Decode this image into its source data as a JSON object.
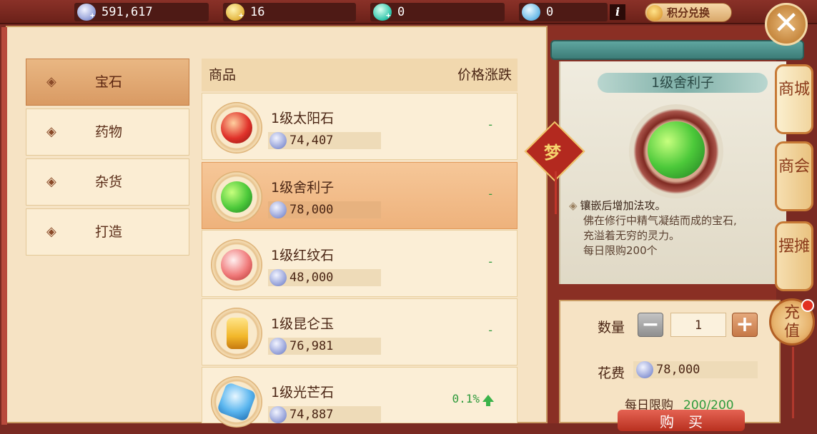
{
  "topbar": {
    "resources": [
      {
        "value": "591,617",
        "icon": "silver-coin-icon"
      },
      {
        "value": "16",
        "icon": "gold-coin-icon"
      },
      {
        "value": "0",
        "icon": "jade-icon"
      },
      {
        "value": "0",
        "icon": "blue-gem-icon"
      }
    ],
    "info_label": "i",
    "exchange_label": "积分兑换",
    "close_label": "✕"
  },
  "categories": [
    {
      "label": "宝石",
      "active": true
    },
    {
      "label": "药物",
      "active": false
    },
    {
      "label": "杂货",
      "active": false
    },
    {
      "label": "打造",
      "active": false
    }
  ],
  "list": {
    "col_item": "商品",
    "col_change": "价格涨跌",
    "items": [
      {
        "name": "1级太阳石",
        "price": "74,407",
        "change": "-",
        "gem_color": "#e0322a"
      },
      {
        "name": "1级舍利子",
        "price": "78,000",
        "change": "-",
        "gem_color": "#4cc93a"
      },
      {
        "name": "1级红纹石",
        "price": "48,000",
        "change": "-",
        "gem_color": "#f07a7a"
      },
      {
        "name": "1级昆仑玉",
        "price": "76,981",
        "change": "-",
        "gem_color": "#f2b72a"
      },
      {
        "name": "1级光芒石",
        "price": "74,887",
        "change": "0.1%",
        "gem_color": "#5bb6ef"
      }
    ]
  },
  "detail": {
    "knot_char": "梦",
    "title": "1级舍利子",
    "lead": "镶嵌后增加法攻。",
    "desc_lines": [
      "佛在修行中精气凝结而成的宝石,",
      "充溢着无穷的灵力。",
      "每日限购200个"
    ]
  },
  "buy": {
    "qty_label": "数量",
    "minus": "−",
    "qty_value": "1",
    "plus": "+",
    "cost_label": "花费",
    "cost_value": "78,000",
    "limit_label": "每日限购",
    "limit_value": "200/200",
    "buy_label": "购买"
  },
  "side_tabs": [
    "商城",
    "商会",
    "摆摊"
  ],
  "recharge_label": "充值"
}
